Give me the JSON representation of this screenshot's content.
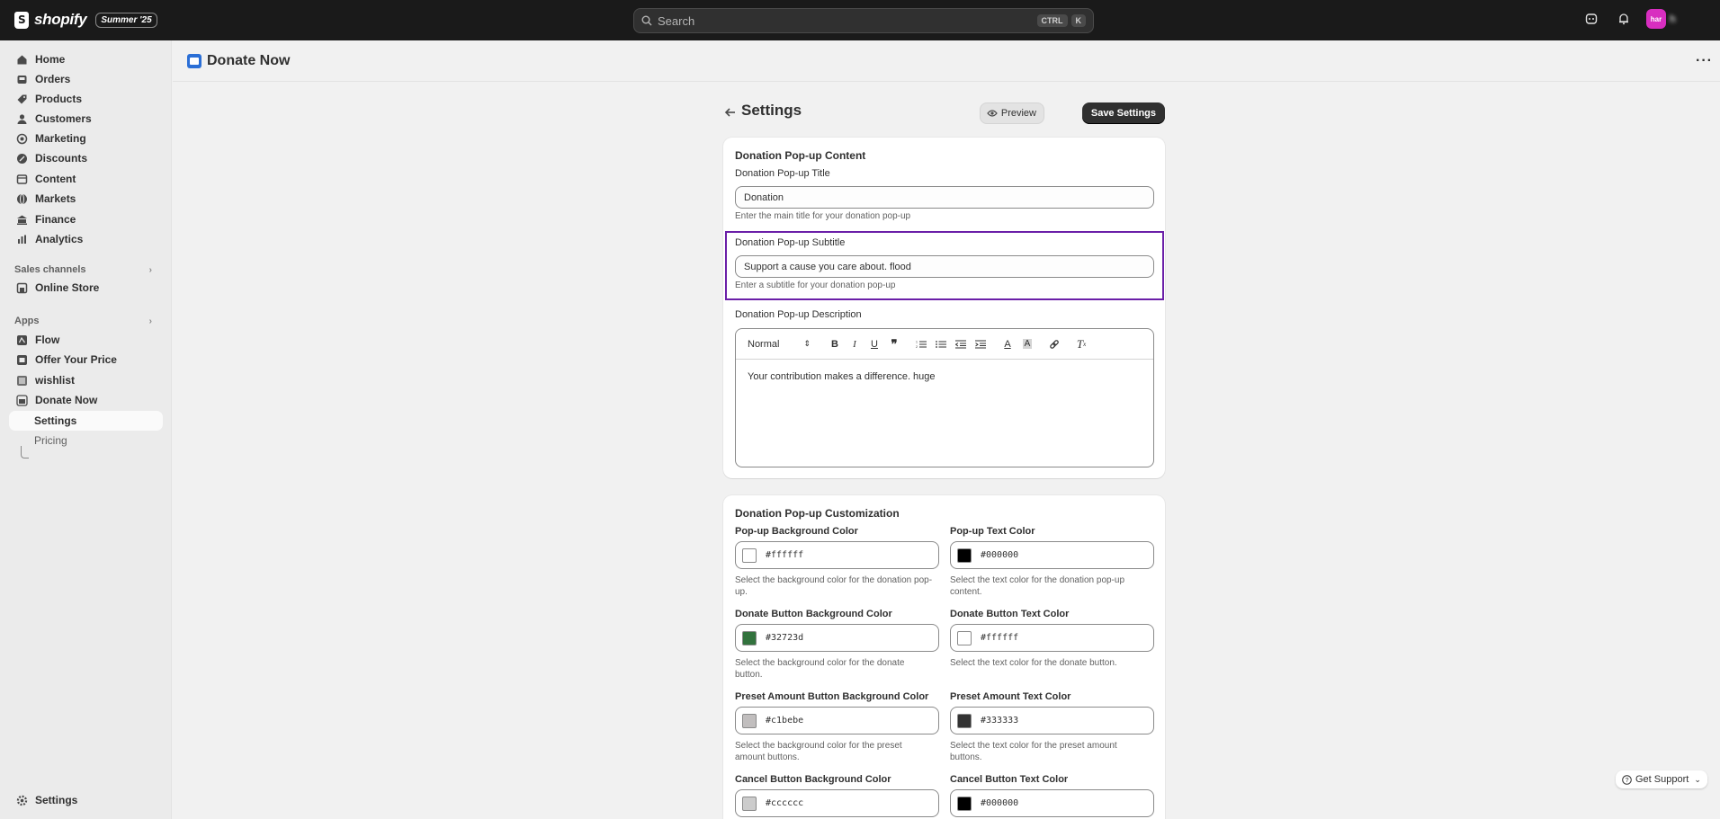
{
  "topbar": {
    "brand": "shopify",
    "badge": "Summer '25",
    "search_placeholder": "Search",
    "shortcut_keys": [
      "CTRL",
      "K"
    ],
    "avatar_initials": "har",
    "avatar_name": "h"
  },
  "sidebar": {
    "items": [
      {
        "label": "Home",
        "icon": "home-icon"
      },
      {
        "label": "Orders",
        "icon": "inbox-icon"
      },
      {
        "label": "Products",
        "icon": "tag-icon"
      },
      {
        "label": "Customers",
        "icon": "person-icon"
      },
      {
        "label": "Marketing",
        "icon": "target-icon"
      },
      {
        "label": "Discounts",
        "icon": "discount-icon"
      },
      {
        "label": "Content",
        "icon": "content-icon"
      },
      {
        "label": "Markets",
        "icon": "globe-icon"
      },
      {
        "label": "Finance",
        "icon": "bank-icon"
      },
      {
        "label": "Analytics",
        "icon": "chart-icon"
      }
    ],
    "sales_channels_label": "Sales channels",
    "sales_channels": [
      {
        "label": "Online Store",
        "icon": "store-icon"
      }
    ],
    "apps_label": "Apps",
    "apps": [
      {
        "label": "Flow",
        "icon": "flow-icon"
      },
      {
        "label": "Offer Your Price",
        "icon": "offer-icon"
      },
      {
        "label": "wishlist",
        "icon": "wishlist-icon"
      },
      {
        "label": "Donate Now",
        "icon": "donate-icon"
      }
    ],
    "app_subitems": [
      {
        "label": "Settings"
      },
      {
        "label": "Pricing"
      }
    ],
    "settings_label": "Settings"
  },
  "app_header": {
    "title": "Donate Now"
  },
  "page": {
    "title": "Settings",
    "preview_label": "Preview",
    "save_label": "Save Settings"
  },
  "content_card": {
    "title": "Donation Pop-up Content",
    "popup_title": {
      "label": "Donation Pop-up Title",
      "value": "Donation",
      "help": "Enter the main title for your donation pop-up"
    },
    "popup_subtitle": {
      "label": "Donation Pop-up Subtitle",
      "value": "Support a cause you care about. flood",
      "help": "Enter a subtitle for your donation pop-up"
    },
    "popup_description": {
      "label": "Donation Pop-up Description",
      "format": "Normal",
      "value": "Your contribution makes a difference. huge"
    }
  },
  "customization_card": {
    "title": "Donation Pop-up Customization",
    "fields": [
      {
        "label": "Pop-up Background Color",
        "value": "#ffffff",
        "help": "Select the background color for the donation pop-up."
      },
      {
        "label": "Pop-up Text Color",
        "value": "#000000",
        "help": "Select the text color for the donation pop-up content."
      },
      {
        "label": "Donate Button Background Color",
        "value": "#32723d",
        "help": "Select the background color for the donate button."
      },
      {
        "label": "Donate Button Text Color",
        "value": "#ffffff",
        "help": "Select the text color for the donate button."
      },
      {
        "label": "Preset Amount Button Background Color",
        "value": "#c1bebe",
        "help": "Select the background color for the preset amount buttons."
      },
      {
        "label": "Preset Amount Text Color",
        "value": "#333333",
        "help": "Select the text color for the preset amount buttons."
      },
      {
        "label": "Cancel Button Background Color",
        "value": "#cccccc",
        "help": ""
      },
      {
        "label": "Cancel Button Text Color",
        "value": "#000000",
        "help": ""
      }
    ]
  },
  "support": {
    "label": "Get Support"
  },
  "colors": {
    "topbar": "#1a1a1a",
    "highlight": "#6b1fa8",
    "primary_button": "#303030"
  }
}
